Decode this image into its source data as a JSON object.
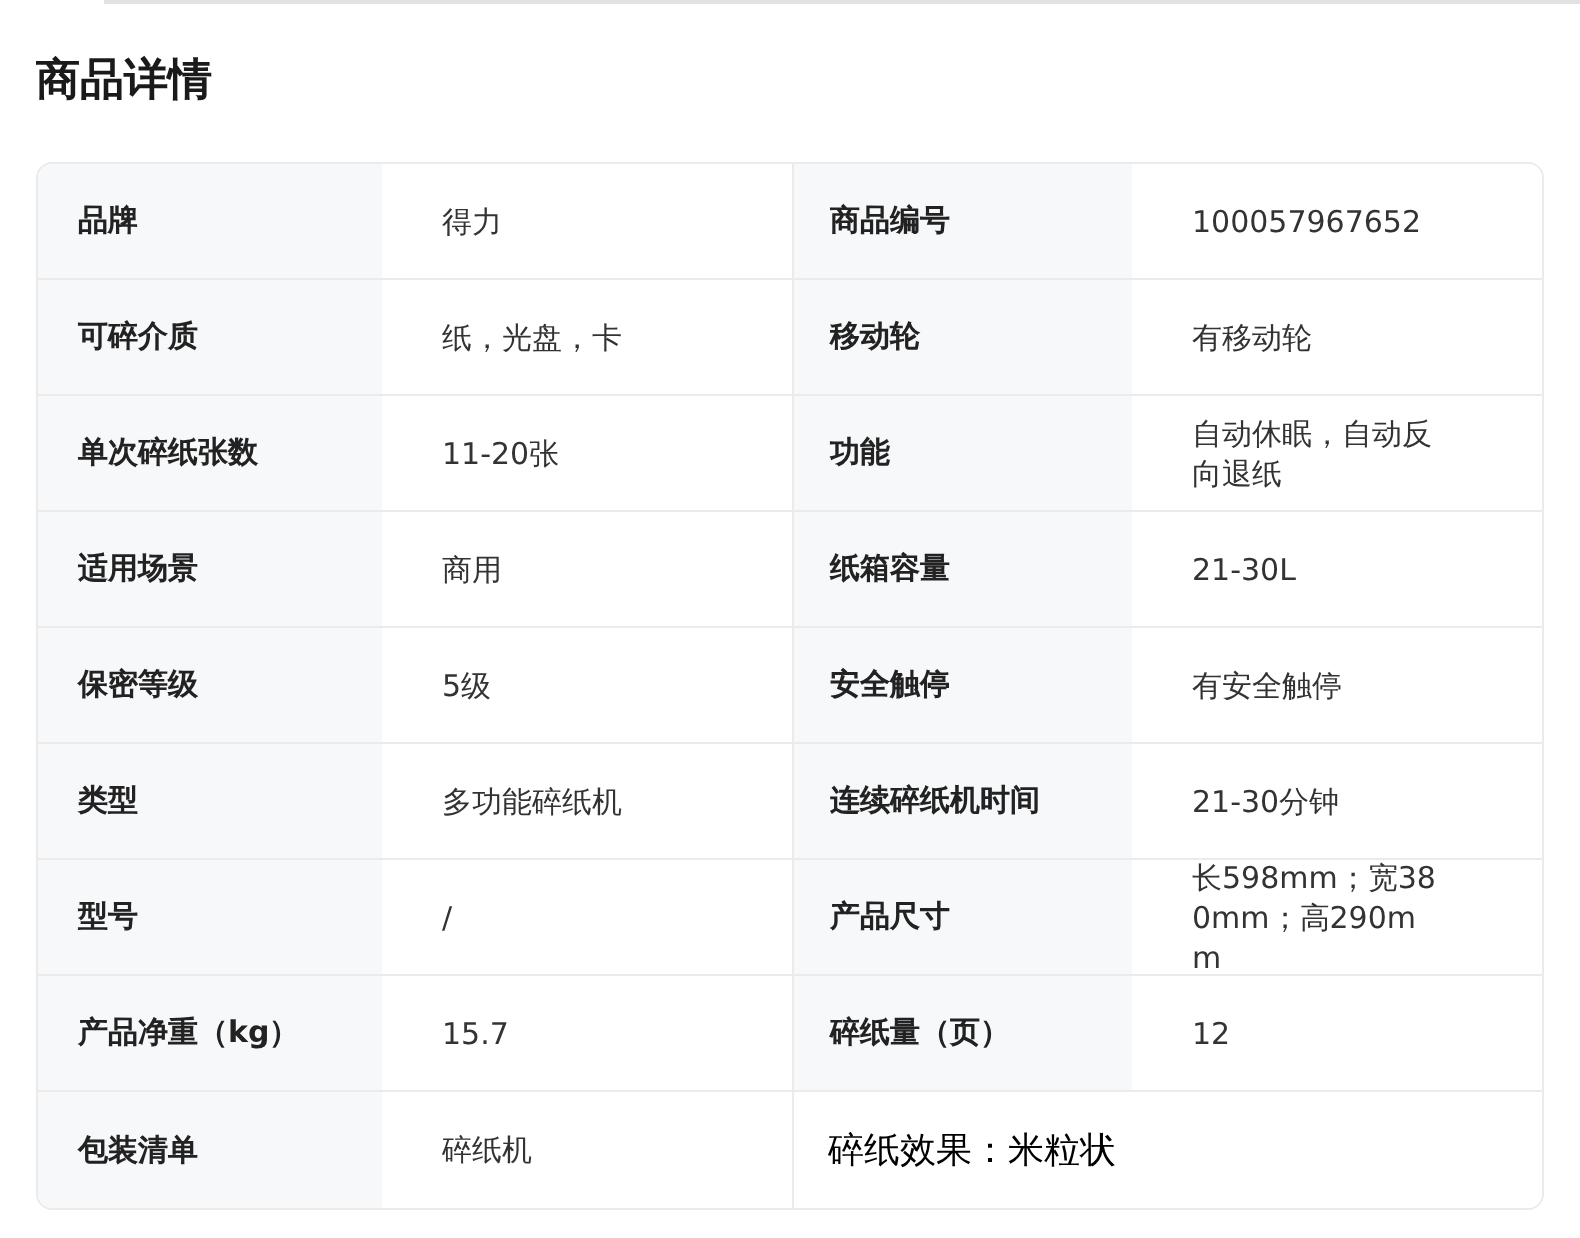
{
  "title": "商品详情",
  "rows": [
    {
      "left": {
        "label": "品牌",
        "value": "得力"
      },
      "right": {
        "kind": "pair",
        "label": "商品编号",
        "value": "100057967652"
      }
    },
    {
      "left": {
        "label": "可碎介质",
        "value": "纸，光盘，卡"
      },
      "right": {
        "kind": "pair",
        "label": "移动轮",
        "value": "有移动轮"
      }
    },
    {
      "left": {
        "label": "单次碎纸张数",
        "value": "11-20张"
      },
      "right": {
        "kind": "pair",
        "label": "功能",
        "value": "自动休眠，自动反向退纸"
      }
    },
    {
      "left": {
        "label": "适用场景",
        "value": "商用"
      },
      "right": {
        "kind": "pair",
        "label": "纸箱容量",
        "value": "21-30L"
      }
    },
    {
      "left": {
        "label": "保密等级",
        "value": "5级"
      },
      "right": {
        "kind": "pair",
        "label": "安全触停",
        "value": "有安全触停"
      }
    },
    {
      "left": {
        "label": "类型",
        "value": "多功能碎纸机"
      },
      "right": {
        "kind": "pair",
        "label": "连续碎纸机时间",
        "value": "21-30分钟"
      }
    },
    {
      "left": {
        "label": "型号",
        "value": "/"
      },
      "right": {
        "kind": "pair",
        "label": "产品尺寸",
        "value": "长598mm；宽380mm；高290mm"
      }
    },
    {
      "left": {
        "label": "产品净重（kg）",
        "value": "15.7"
      },
      "right": {
        "kind": "pair",
        "label": "碎纸量（页）",
        "value": "12"
      }
    },
    {
      "left": {
        "label": "包装清单",
        "value": "碎纸机"
      },
      "right": {
        "kind": "note",
        "text": "碎纸效果：米粒状"
      }
    }
  ]
}
